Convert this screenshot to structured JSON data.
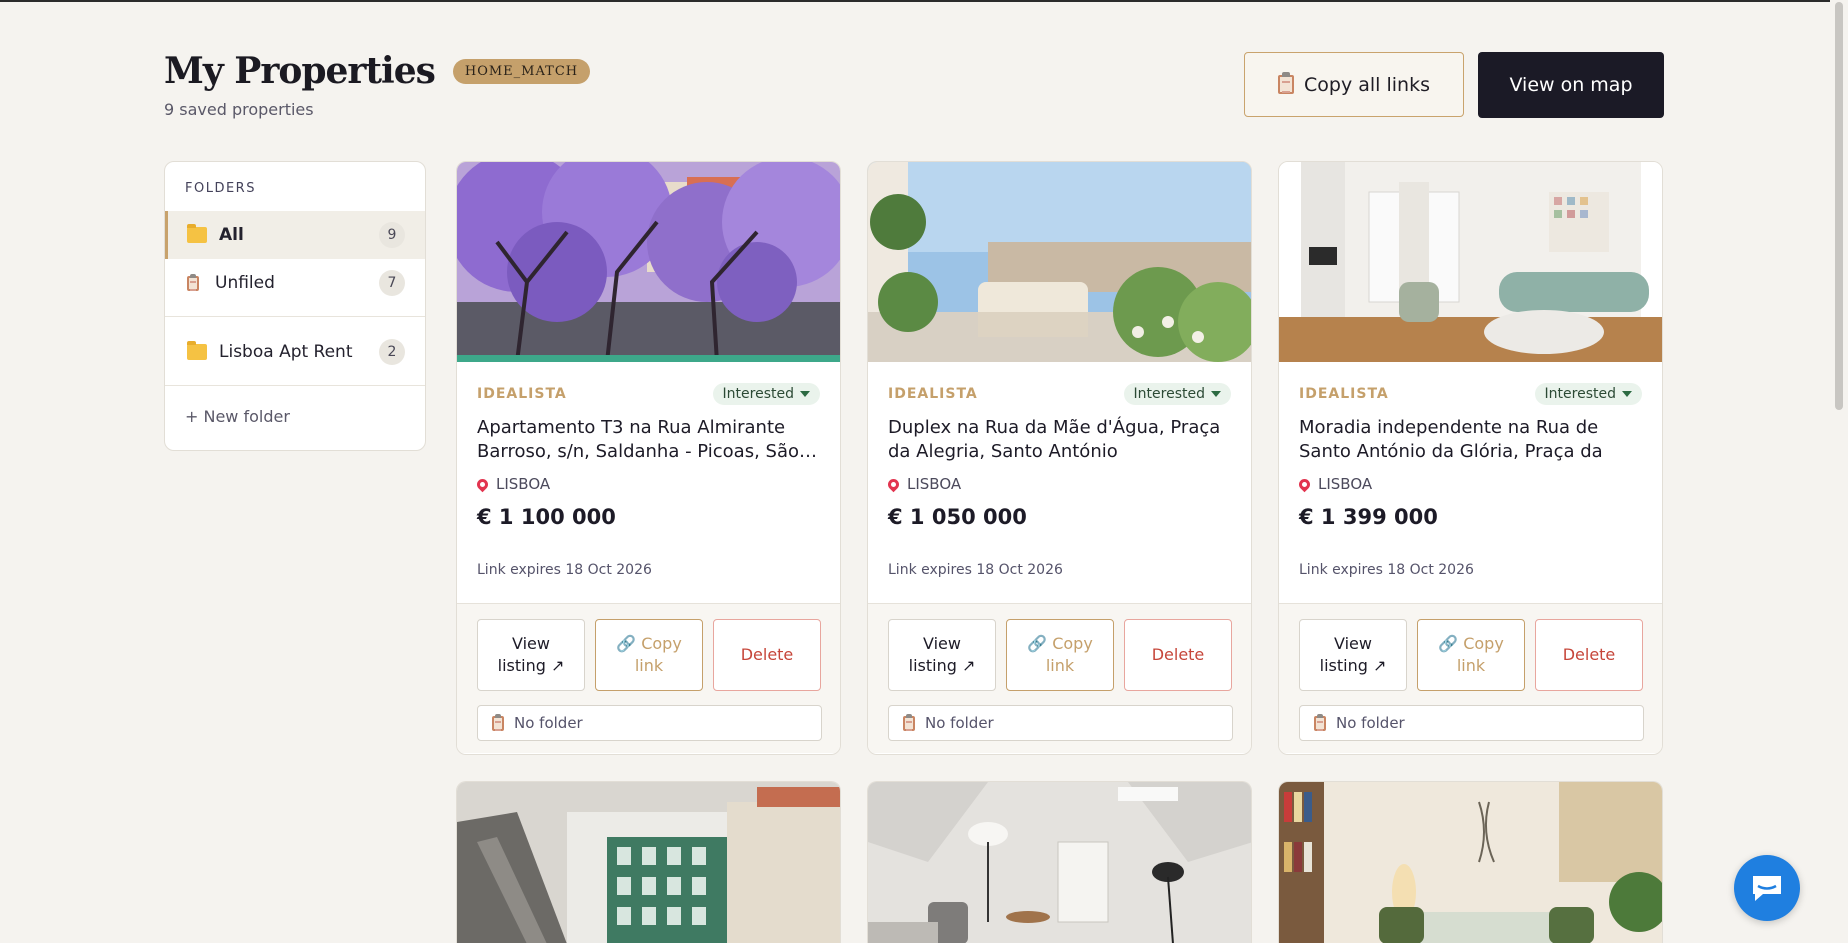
{
  "page": {
    "title": "My Properties",
    "tag": "HOME_MATCH",
    "subtitle": "9 saved properties",
    "copy_all_label": "Copy all links",
    "view_map_label": "View on map"
  },
  "sidebar": {
    "heading": "FOLDERS",
    "folders": [
      {
        "name": "All",
        "count": "9",
        "icon": "folder-icon"
      },
      {
        "name": "Unfiled",
        "count": "7",
        "icon": "clipboard-icon"
      },
      {
        "name": "Lisboa Apt Rent",
        "count": "2",
        "icon": "folder-icon"
      }
    ],
    "new_folder": "+ New folder"
  },
  "cards": [
    {
      "source": "IDEALISTA",
      "status": "Interested",
      "title": "Apartamento T3 na Rua Almirante Barroso, s/n, Saldanha - Picoas, São…",
      "location": "LISBOA",
      "price": "€ 1 100 000",
      "expires": "Link expires 18 Oct 2026",
      "view_label": "View listing ↗",
      "copy_label": "Copy link",
      "delete_label": "Delete",
      "folder": "No folder"
    },
    {
      "source": "IDEALISTA",
      "status": "Interested",
      "title": "Duplex na Rua da Mãe d'Água, Praça da Alegria, Santo António",
      "location": "LISBOA",
      "price": "€ 1 050 000",
      "expires": "Link expires 18 Oct 2026",
      "view_label": "View listing ↗",
      "copy_label": "Copy link",
      "delete_label": "Delete",
      "folder": "No folder"
    },
    {
      "source": "IDEALISTA",
      "status": "Interested",
      "title": "Moradia independente na Rua de Santo António da Glória, Praça da Alegria,…",
      "location": "LISBOA",
      "price": "€ 1 399 000",
      "expires": "Link expires 18 Oct 2026",
      "view_label": "View listing ↗",
      "copy_label": "Copy link",
      "delete_label": "Delete",
      "folder": "No folder"
    }
  ],
  "colors": {
    "accent_gold": "#c5a06b",
    "dark_button": "#1b1a26",
    "delete_red": "#c6463a",
    "status_bg": "#eaf3ec",
    "chat_blue": "#1f7fe0"
  },
  "chat": {
    "icon": "chat-bubble-icon"
  }
}
